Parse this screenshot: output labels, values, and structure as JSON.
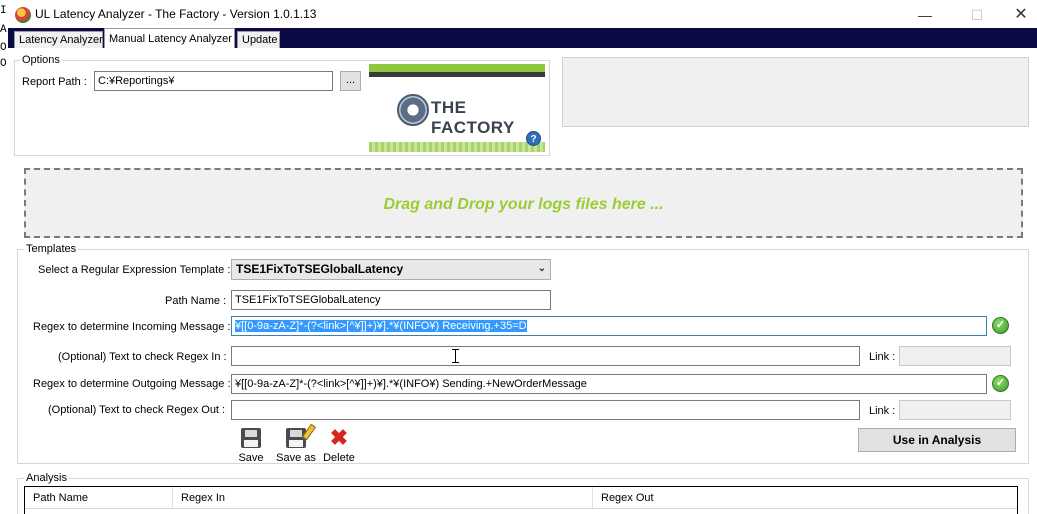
{
  "window": {
    "title": "UL Latency Analyzer - The Factory - Version 1.0.1.13",
    "gutter_chars": [
      "I",
      "A",
      "O",
      "O"
    ]
  },
  "tabs": [
    {
      "label": "Latency Analyzer"
    },
    {
      "label": "Manual Latency Analyzer"
    },
    {
      "label": "Update"
    }
  ],
  "options": {
    "legend": "Options",
    "report_path_label": "Report Path :",
    "report_path_value": "C:¥Reportings¥",
    "browse_label": "..."
  },
  "logo": {
    "text": "THE FACTORY",
    "help_glyph": "?"
  },
  "dropzone": {
    "text": "Drag and Drop your logs files here ..."
  },
  "templates": {
    "legend": "Templates",
    "select_label": "Select a Regular Expression Template :",
    "select_value": "TSE1FixToTSEGlobalLatency",
    "path_name_label": "Path Name :",
    "path_name_value": "TSE1FixToTSEGlobalLatency",
    "incoming_label": "Regex to determine Incoming Message :",
    "incoming_value": "¥[[0-9a-zA-Z]*-(?<link>[^¥]]+)¥].*¥(INFO¥) Receiving.+35=D",
    "optional_in_label": "(Optional) Text to check Regex In :",
    "optional_in_value": "",
    "outgoing_label": "Regex to determine Outgoing Message :",
    "outgoing_value": "¥[[0-9a-zA-Z]*-(?<link>[^¥]]+)¥].*¥(INFO¥) Sending.+NewOrderMessage",
    "optional_out_label": "(Optional) Text to check Regex Out :",
    "optional_out_value": "",
    "link_label": "Link :",
    "save_label": "Save",
    "save_as_label": "Save as",
    "delete_label": "Delete",
    "use_in_analysis_label": "Use in Analysis"
  },
  "analysis": {
    "legend": "Analysis",
    "columns": [
      "Path Name",
      "Regex In",
      "Regex Out"
    ]
  },
  "colors": {
    "tabstrip": "#0b0a44",
    "dropzone_text": "#9acd32",
    "selection": "#3399ff"
  }
}
